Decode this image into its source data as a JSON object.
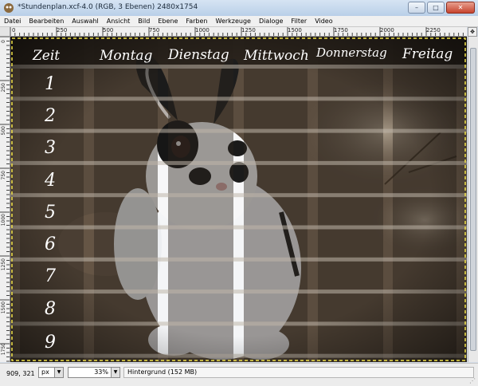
{
  "window": {
    "title": "*Stundenplan.xcf-4.0 (RGB, 3 Ebenen) 2480x1754",
    "minimize_label": "–",
    "maximize_label": "□",
    "close_label": "✕"
  },
  "menu": {
    "items": [
      "Datei",
      "Bearbeiten",
      "Auswahl",
      "Ansicht",
      "Bild",
      "Ebene",
      "Farben",
      "Werkzeuge",
      "Dialoge",
      "Filter",
      "Video"
    ]
  },
  "ruler": {
    "top_labels": [
      "0",
      "250",
      "500",
      "750",
      "1000",
      "1250",
      "1500",
      "1750",
      "2000",
      "2250"
    ],
    "left_labels": [
      "0",
      "250",
      "500",
      "750",
      "1000",
      "1250",
      "1500",
      "1750"
    ]
  },
  "canvas": {
    "headers": [
      "Zeit",
      "Montag",
      "Dienstag",
      "Mittwoch",
      "Donnerstag",
      "Freitag"
    ],
    "periods": [
      "1",
      "2",
      "3",
      "4",
      "5",
      "6",
      "7",
      "8",
      "9"
    ]
  },
  "status": {
    "coords": "909, 321",
    "unit": "px",
    "zoom": "33%",
    "layer": "Hintergrund (152 MB)"
  },
  "colors": {
    "accent": "#c7442e",
    "ground": "#5b4d3f",
    "grid_light": "#bfb6aa",
    "selection_border": "#f2e34a"
  }
}
